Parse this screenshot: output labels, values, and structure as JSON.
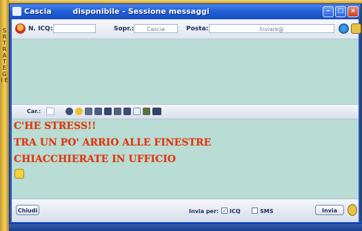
{
  "window": {
    "title": "Cascia        disponibile - Sessione messaggi",
    "controls": [
      "minimize",
      "maximize",
      "close"
    ]
  },
  "left_strip_text": "S R T R A T E G I E",
  "header": {
    "contact_label": "N. ICQ:",
    "contact_value": "",
    "nickname_label": "Sopr.:",
    "nickname_value": "Cascia",
    "email_label": "Posta:",
    "email_value": "Inviare@"
  },
  "format_toolbar": {
    "label": "Car.:",
    "icons": [
      "bold-icon",
      "smiley-icon",
      "person-icon",
      "grid-icon",
      "image-icon",
      "list-icon",
      "calendar-icon",
      "page-icon",
      "photo-icon",
      "more-icon"
    ]
  },
  "compose": {
    "lines": [
      "C'HE STRESS!!",
      "TRA UN PO' ARRIO ALLE FINESTRE",
      "CHIACCHIERATE IN UFFICIO"
    ]
  },
  "footer": {
    "close_button": "Chiudi",
    "send_via_label": "Invia per:",
    "icq_option": "ICQ",
    "icq_checked": true,
    "sms_option": "SMS",
    "sms_checked": false,
    "send_button": "Invia"
  },
  "colors": {
    "title_bar": "#2160d6",
    "chat_background": "#b9dcd4",
    "message_text": "#d93a18",
    "frame_gold": "#e6bf4a"
  }
}
